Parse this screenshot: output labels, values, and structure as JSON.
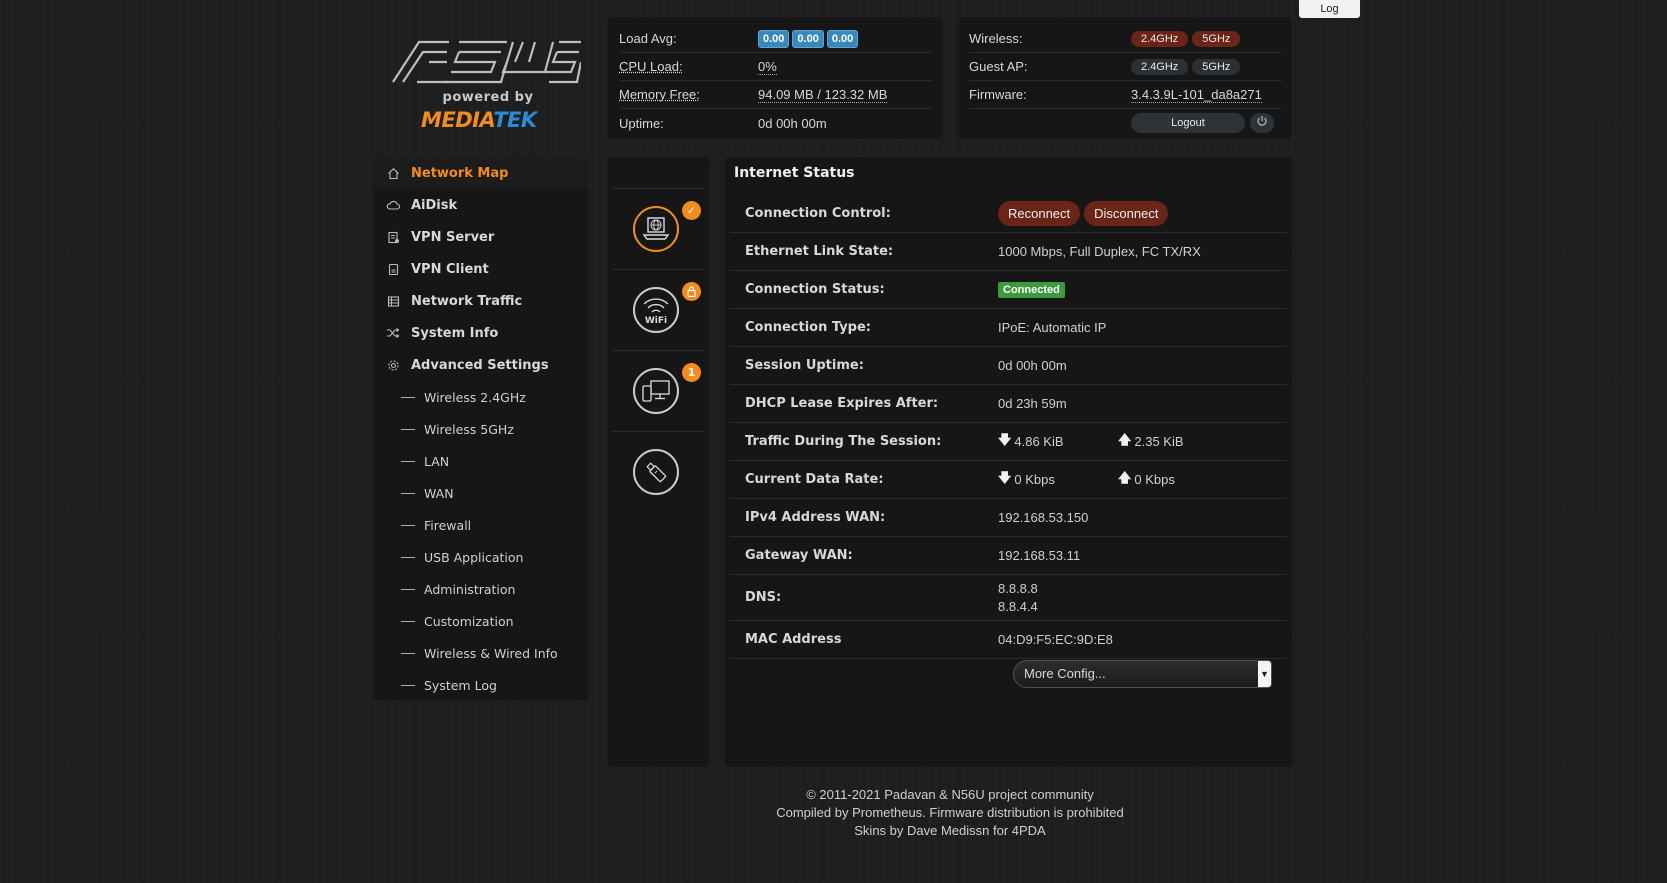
{
  "header": {
    "log_button": "Log"
  },
  "logo": {
    "brand": "ASUS",
    "powered_by": "powered by",
    "vendor_part1": "MEDIA",
    "vendor_part2": "TEK"
  },
  "system": {
    "load_avg_label": "Load Avg:",
    "load_avg": [
      "0.00",
      "0.00",
      "0.00"
    ],
    "cpu_load_label": "CPU Load:",
    "cpu_load": "0%",
    "memory_free_label": "Memory Free:",
    "memory_free": "94.09 MB",
    "memory_sep": " / ",
    "memory_total": "123.32 MB",
    "uptime_label": "Uptime:",
    "uptime": "0d 00h 00m"
  },
  "wireless": {
    "wireless_label": "Wireless:",
    "band_24": "2.4GHz",
    "band_5": "5GHz",
    "guest_ap_label": "Guest AP:",
    "guest_24": "2.4GHz",
    "guest_5": "5GHz",
    "firmware_label": "Firmware:",
    "firmware": "3.4.3.9L-101_da8a271",
    "logout": "Logout",
    "power_icon": "power-icon",
    "active_band_color": "#6a2418",
    "inactive_band_color": "#2b3034"
  },
  "sidebar": {
    "items": [
      {
        "label": "Network Map",
        "icon": "home-icon",
        "active": true
      },
      {
        "label": "AiDisk",
        "icon": "cloud-icon"
      },
      {
        "label": "VPN Server",
        "icon": "server-icon"
      },
      {
        "label": "VPN Client",
        "icon": "client-icon"
      },
      {
        "label": "Network Traffic",
        "icon": "traffic-icon"
      },
      {
        "label": "System Info",
        "icon": "shuffle-icon"
      },
      {
        "label": "Advanced Settings",
        "icon": "gear-icon"
      }
    ],
    "sub_items": [
      "Wireless 2.4GHz",
      "Wireless 5GHz",
      "LAN",
      "WAN",
      "Firewall",
      "USB Application",
      "Administration",
      "Customization",
      "Wireless & Wired Info",
      "System Log"
    ]
  },
  "status_icons": [
    {
      "icon": "internet-icon",
      "badge": "✓",
      "active": true
    },
    {
      "icon": "wifi-icon",
      "badge": "lock"
    },
    {
      "icon": "clients-icon",
      "badge": "1"
    },
    {
      "icon": "usb-icon",
      "badge": ""
    }
  ],
  "main": {
    "title": "Internet Status",
    "connection_control_label": "Connection Control:",
    "reconnect": "Reconnect",
    "disconnect": "Disconnect",
    "ethernet_label": "Ethernet Link State:",
    "ethernet": "1000 Mbps, Full Duplex, FC TX/RX",
    "conn_status_label": "Connection Status:",
    "conn_status": "Connected",
    "conn_type_label": "Connection Type:",
    "conn_type": "IPoE: Automatic IP",
    "session_uptime_label": "Session Uptime:",
    "session_uptime": "0d 00h 00m",
    "dhcp_label": "DHCP Lease Expires After:",
    "dhcp": "0d 23h 59m",
    "traffic_label": "Traffic During The Session:",
    "traffic_down": "4.86 KiB",
    "traffic_up": "2.35 KiB",
    "rate_label": "Current Data Rate:",
    "rate_down": "0 Kbps",
    "rate_up": "0 Kbps",
    "ipv4_label": "IPv4 Address WAN:",
    "ipv4": "192.168.53.150",
    "gateway_label": "Gateway WAN:",
    "gateway": "192.168.53.11",
    "dns_label": "DNS:",
    "dns1": "8.8.8.8",
    "dns2": "8.8.4.4",
    "mac_label": "MAC Address",
    "mac": "04:D9:F5:EC:9D:E8",
    "more_config": "More Config..."
  },
  "footer": {
    "line1": "© 2011-2021 Padavan & N56U project community",
    "line2": "Compiled by Prometheus. Firmware distribution is prohibited",
    "line3": "Skins by Dave Medissn for 4PDA"
  },
  "colors": {
    "accent": "#f28c1d",
    "mediatek_blue": "#2a8bd6",
    "badge_blue": "#3688bd",
    "connected_green": "#3b9a3b",
    "button_red": "#6a2418"
  }
}
